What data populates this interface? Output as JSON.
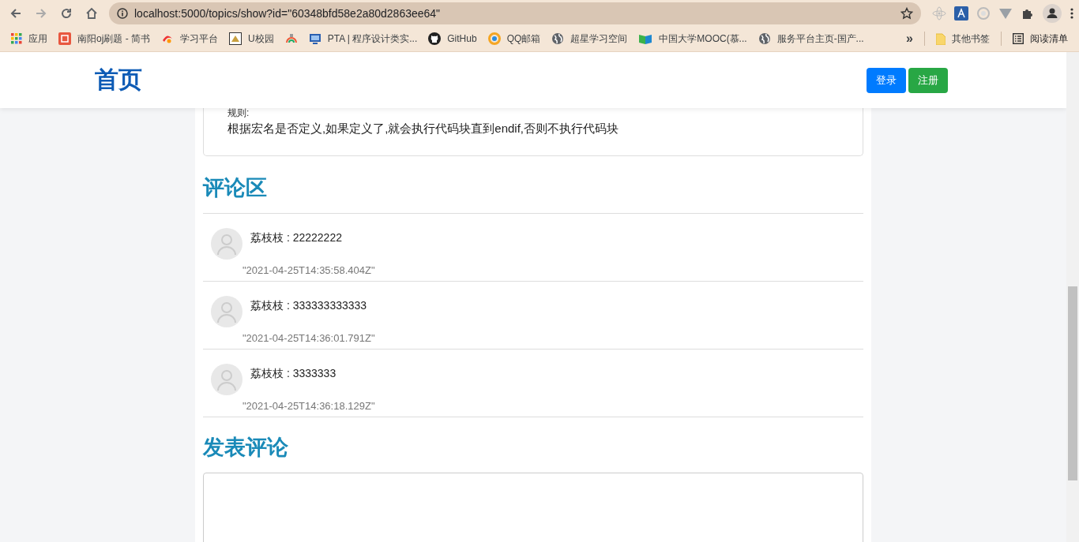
{
  "browser": {
    "url": "localhost:5000/topics/show?id=\"60348bfd58e2a80d2863ee64\"",
    "bookmarks": [
      {
        "label": "应用",
        "kind": "apps"
      },
      {
        "label": "南阳oj刷题 - 简书",
        "kind": "jian"
      },
      {
        "label": "学习平台",
        "kind": "study"
      },
      {
        "label": "U校园",
        "kind": "ux"
      },
      {
        "kind": "cloud"
      },
      {
        "label": "PTA | 程序设计类实...",
        "kind": "pta"
      },
      {
        "label": "GitHub",
        "kind": "github"
      },
      {
        "label": "QQ邮箱",
        "kind": "qq"
      },
      {
        "label": "超星学习空间",
        "kind": "globe"
      },
      {
        "label": "中国大学MOOC(慕...",
        "kind": "mooc"
      },
      {
        "label": "服务平台主页-国产...",
        "kind": "globe"
      }
    ],
    "overflow": "»",
    "other_bookmarks": "其他书签",
    "reading_list": "阅读清单"
  },
  "header": {
    "title": "首页",
    "buttons": [
      {
        "label": "登录",
        "kind": "primary"
      },
      {
        "label": "注册",
        "kind": "success"
      }
    ]
  },
  "topic": {
    "lines": [
      "规则:",
      "根据宏名是否定义,如果定义了,就会执行代码块直到endif,否则不执行代码块"
    ]
  },
  "comments_heading": "评论区",
  "comments": [
    {
      "text": "荔枝枝 : 22222222",
      "time": "\"2021-04-25T14:35:58.404Z\""
    },
    {
      "text": "荔枝枝 : 333333333333",
      "time": "\"2021-04-25T14:36:01.791Z\""
    },
    {
      "text": "荔枝枝 : 3333333",
      "time": "\"2021-04-25T14:36:18.129Z\""
    }
  ],
  "post_heading": "发表评论"
}
